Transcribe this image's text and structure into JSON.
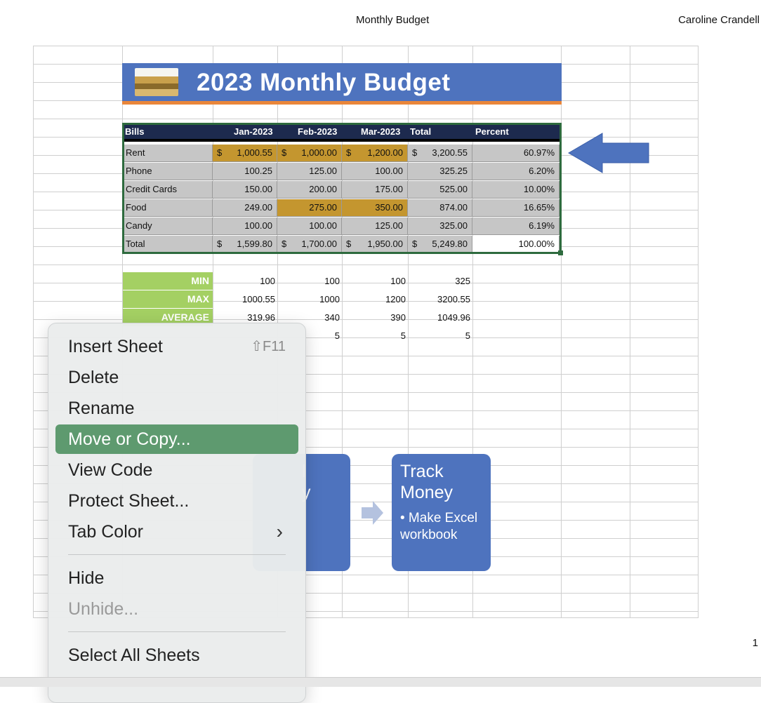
{
  "header": {
    "title": "Monthly Budget",
    "author": "Caroline Crandell",
    "page_number": "1"
  },
  "banner": {
    "title": "2023 Monthly Budget",
    "image_icon": "coins-stack-icon"
  },
  "table": {
    "headers": [
      "Bills",
      "Jan-2023",
      "Feb-2023",
      "Mar-2023",
      "Total",
      "Percent"
    ],
    "rows": [
      {
        "label": "Rent",
        "jan": "1,000.55",
        "feb": "1,000.00",
        "mar": "1,200.00",
        "total": "3,200.55",
        "pct": "60.97%"
      },
      {
        "label": "Phone",
        "jan": "100.25",
        "feb": "125.00",
        "mar": "100.00",
        "total": "325.25",
        "pct": "6.20%"
      },
      {
        "label": "Credit Cards",
        "jan": "150.00",
        "feb": "200.00",
        "mar": "175.00",
        "total": "525.00",
        "pct": "10.00%"
      },
      {
        "label": "Food",
        "jan": "249.00",
        "feb": "275.00",
        "mar": "350.00",
        "total": "874.00",
        "pct": "16.65%"
      },
      {
        "label": "Candy",
        "jan": "100.00",
        "feb": "100.00",
        "mar": "125.00",
        "total": "325.00",
        "pct": "6.19%"
      },
      {
        "label": "Total",
        "jan": "1,599.80",
        "feb": "1,700.00",
        "mar": "1,950.00",
        "total": "5,249.80",
        "pct": "100.00%"
      }
    ],
    "currency": "$"
  },
  "stats": {
    "labels": [
      "MIN",
      "MAX",
      "AVERAGE"
    ],
    "rows": [
      [
        "100",
        "100",
        "100",
        "325"
      ],
      [
        "1000.55",
        "1000",
        "1200",
        "3200.55"
      ],
      [
        "319.96",
        "340",
        "390",
        "1049.96"
      ],
      [
        "",
        "5",
        "5",
        "5"
      ]
    ]
  },
  "smartart": {
    "box1_title_fragment": "l",
    "box1_line2_fragment": "y",
    "box2_title": "Track Money",
    "box2_bullet": "• Make Excel workbook"
  },
  "menu": {
    "items": {
      "insert_sheet": "Insert Sheet",
      "insert_sheet_shortcut": "⇧F11",
      "delete": "Delete",
      "rename": "Rename",
      "move_copy": "Move or Copy...",
      "view_code": "View Code",
      "protect_sheet": "Protect Sheet...",
      "tab_color": "Tab Color",
      "hide": "Hide",
      "unhide": "Unhide...",
      "select_all": "Select All Sheets"
    },
    "active_color": "#5e9a6f"
  },
  "colors": {
    "banner": "#4e73be",
    "accent_line": "#e9863a",
    "gold": "#c4962f",
    "stat_green": "#a4d063",
    "header_navy": "#1d2a4e"
  }
}
